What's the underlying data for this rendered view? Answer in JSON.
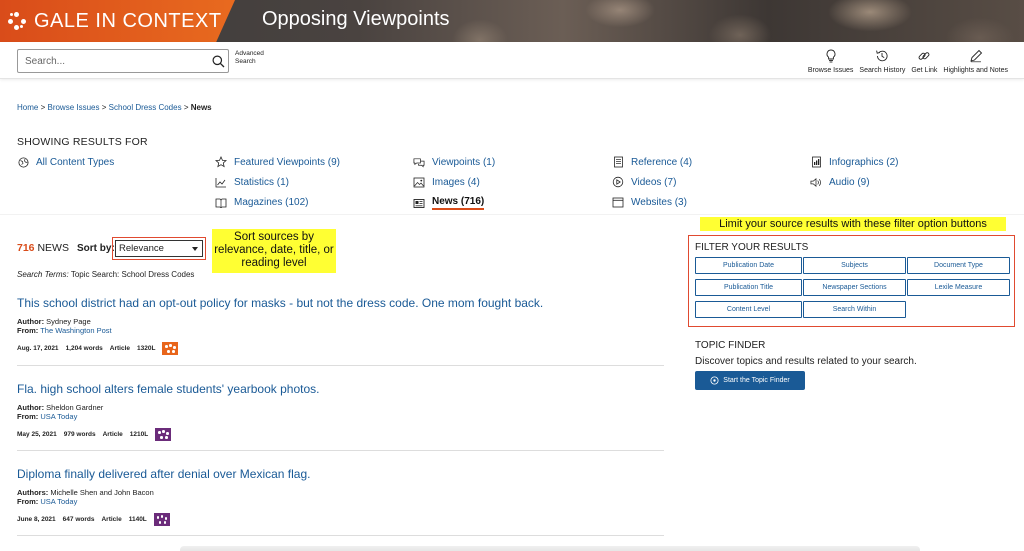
{
  "header": {
    "brand": "GALE IN CONTEXT",
    "product": "Opposing Viewpoints"
  },
  "search": {
    "placeholder": "Search...",
    "advanced_label": "Advanced Search"
  },
  "tools": [
    {
      "label": "Browse Issues",
      "icon": "lightbulb-icon"
    },
    {
      "label": "Search History",
      "icon": "history-icon"
    },
    {
      "label": "Get Link",
      "icon": "link-icon"
    },
    {
      "label": "Highlights and Notes",
      "icon": "pen-icon"
    }
  ],
  "breadcrumb": {
    "home": "Home",
    "browse": "Browse Issues",
    "topic": "School Dress Codes",
    "current": "News",
    "sep": ">"
  },
  "showing_label": "SHOWING RESULTS FOR",
  "content_types": {
    "all": "All Content Types",
    "featured": "Featured Viewpoints  (9)",
    "viewpoints": "Viewpoints  (1)",
    "reference": "Reference  (4)",
    "infographics": "Infographics  (2)",
    "statistics": "Statistics  (1)",
    "images": "Images  (4)",
    "videos": "Videos  (7)",
    "audio": "Audio  (9)",
    "magazines": "Magazines  (102)",
    "news": "News  (716)",
    "websites": "Websites  (3)"
  },
  "results": {
    "count": "716",
    "count_label": " NEWS",
    "sort_label": "Sort by:",
    "sort_value": "Relevance",
    "search_terms_label": "Search Terms:",
    "search_terms_value": " Topic Search: School Dress Codes"
  },
  "callouts": {
    "sort": "Sort sources by relevance, date, title, or reading level",
    "filter": "Limit your source results with these filter option buttons"
  },
  "articles": [
    {
      "title": "This school district had an opt-out policy for masks - but not the dress code. One mom fought back.",
      "author_label": "Author:",
      "author": " Sydney Page",
      "from_label": "From:",
      "from": "The Washington Post",
      "date": "Aug. 17, 2021",
      "words": "1,204 words",
      "type": "Article",
      "lexile": "1320L",
      "badge_color": "#e8651b"
    },
    {
      "title": "Fla. high school alters female students' yearbook photos.",
      "author_label": "Author:",
      "author": " Sheldon Gardner",
      "from_label": "From:",
      "from": "USA Today",
      "date": "May 25, 2021",
      "words": "979 words",
      "type": "Article",
      "lexile": "1210L",
      "badge_color": "#6b2c7a"
    },
    {
      "title": "Diploma finally delivered after denial over Mexican flag.",
      "author_label": "Authors:",
      "author": " Michelle Shen and John Bacon",
      "from_label": "From:",
      "from": "USA Today",
      "date": "June 8, 2021",
      "words": "647 words",
      "type": "Article",
      "lexile": "1140L",
      "badge_color": "#6b2c7a"
    }
  ],
  "filters": {
    "title": "FILTER YOUR RESULTS",
    "buttons": [
      "Publication Date",
      "Subjects",
      "Document Type",
      "Publication Title",
      "Newspaper Sections",
      "Lexile Measure",
      "Content Level",
      "Search Within"
    ]
  },
  "topic_finder": {
    "title": "TOPIC FINDER",
    "desc": "Discover topics and results related to your search.",
    "button": "Start the Topic Finder"
  },
  "colors": {
    "accent": "#d94c1a",
    "link": "#1a5a96",
    "highlight": "#ffff33"
  }
}
